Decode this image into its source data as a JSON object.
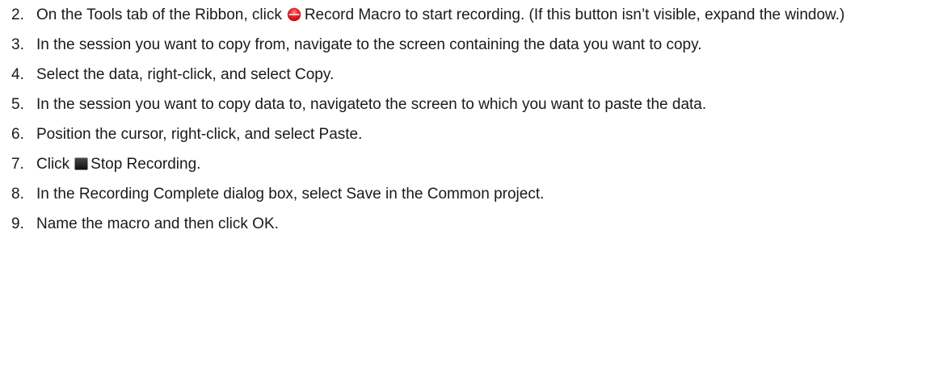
{
  "steps": [
    {
      "number": "2.",
      "before": "On the Tools tab of the Ribbon, click",
      "icon": "record-icon",
      "after": "Record Macro to start recording. (If this button isn’t visible, expand the window.)"
    },
    {
      "number": "3.",
      "text": "In the session you want to copy from, navigate to the screen containing the data you want to copy."
    },
    {
      "number": "4.",
      "text": "Select the data, right-click, and select Copy."
    },
    {
      "number": "5.",
      "text": "In the session you want to copy data to, navigateto the screen to which you want to paste the data."
    },
    {
      "number": "6.",
      "text": "Position the cursor, right-click, and select Paste."
    },
    {
      "number": "7.",
      "before": "Click",
      "icon": "stop-icon",
      "after": "Stop Recording."
    },
    {
      "number": "8.",
      "text": "In the Recording Complete dialog box, select Save in the Common project."
    },
    {
      "number": "9.",
      "text": "Name the macro and then click OK."
    }
  ],
  "colors": {
    "record": "#e8141a",
    "stop": "#1f1f1f"
  }
}
